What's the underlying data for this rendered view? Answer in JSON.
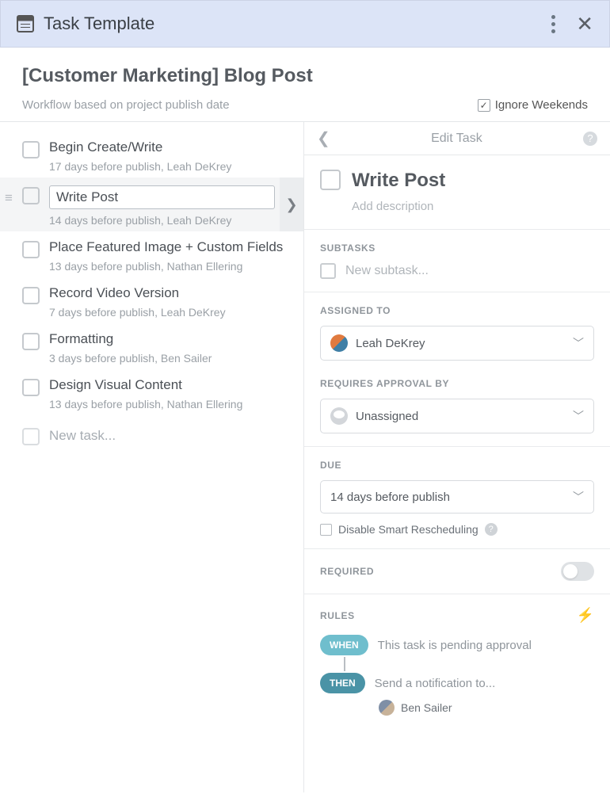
{
  "topbar": {
    "title": "Task Template"
  },
  "header": {
    "project_title": "[Customer Marketing] Blog Post",
    "subtitle": "Workflow based on project publish date",
    "ignore_weekends_label": "Ignore Weekends"
  },
  "tasks": [
    {
      "title": "Begin Create/Write",
      "meta": "17 days before publish,  Leah DeKrey"
    },
    {
      "title": "Write Post",
      "meta": "14 days before publish,  Leah DeKrey",
      "selected": true
    },
    {
      "title": "Place Featured Image + Custom Fields",
      "meta": "13 days before publish,  Nathan Ellering"
    },
    {
      "title": "Record Video Version",
      "meta": "7 days before publish,  Leah DeKrey"
    },
    {
      "title": "Formatting",
      "meta": "3 days before publish,  Ben Sailer"
    },
    {
      "title": "Design Visual Content",
      "meta": "13 days before publish,  Nathan Ellering"
    }
  ],
  "new_task_placeholder": "New task...",
  "detail": {
    "header_title": "Edit Task",
    "title": "Write Post",
    "description_placeholder": "Add description",
    "subtasks_label": "SUBTASKS",
    "new_subtask_placeholder": "New subtask...",
    "assigned_label": "ASSIGNED TO",
    "assigned_value": "Leah DeKrey",
    "approval_label": "REQUIRES APPROVAL BY",
    "approval_value": "Unassigned",
    "due_label": "DUE",
    "due_value": "14 days before publish",
    "disable_resched_label": "Disable Smart Rescheduling",
    "required_label": "REQUIRED",
    "rules_label": "RULES",
    "rule_when_pill": "WHEN",
    "rule_when_text": "This task is pending approval",
    "rule_then_pill": "THEN",
    "rule_then_text": "Send a notification to...",
    "rule_then_person": "Ben Sailer"
  }
}
